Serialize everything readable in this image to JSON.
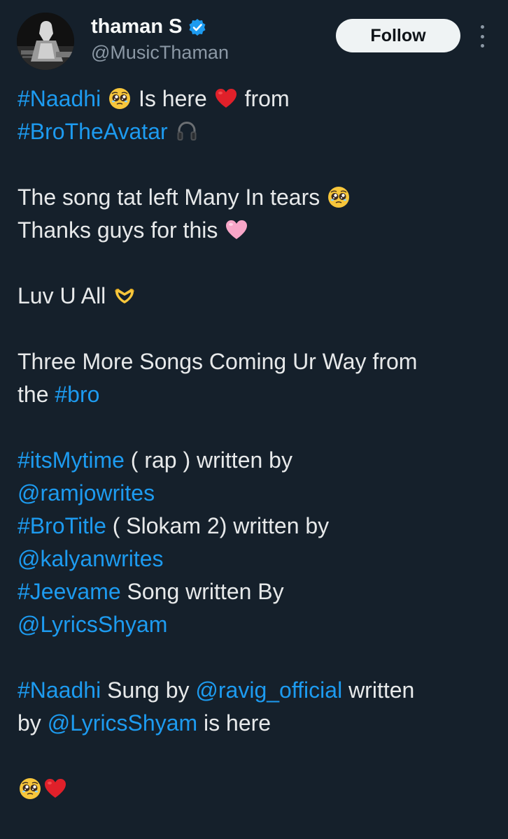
{
  "user": {
    "display_name": "thaman S",
    "handle": "@MusicThaman",
    "verified_icon": "verified-badge-icon",
    "avatar": "profile-avatar"
  },
  "actions": {
    "follow_label": "Follow",
    "more_icon": "more-vertical-icon"
  },
  "colors": {
    "background": "#15202b",
    "text": "#e7e9ea",
    "link": "#1d9bf0",
    "handle": "#8b98a5",
    "follow_button": "#eff3f4"
  },
  "tweet": {
    "l1": {
      "tag_naadhi": "#Naadhi",
      "is_here": " Is here ",
      "from": " from"
    },
    "l2": {
      "tag_brotheavatar": "#BroTheAvatar"
    },
    "l3": {
      "text": "The song tat left Many In tears "
    },
    "l4": {
      "text": "Thanks guys for this "
    },
    "l5": {
      "text": "Luv U All "
    },
    "l6": {
      "text": "Three More Songs Coming Ur Way from"
    },
    "l7": {
      "the": "the ",
      "tag_bro": "#bro"
    },
    "l8": {
      "tag": "#itsMytime",
      "text": " ( rap ) written by"
    },
    "l9": {
      "mention": "@ramjowrites"
    },
    "l10": {
      "tag": "#BroTitle",
      "text": " ( Slokam 2) written by"
    },
    "l11": {
      "mention": "@kalyanwrites"
    },
    "l12": {
      "tag": "#Jeevame",
      "text": " Song written By"
    },
    "l13": {
      "mention": "@LyricsShyam"
    },
    "l14": {
      "tag": "#Naadhi",
      "sung_by": " Sung by ",
      "mention": "@ravig_official",
      "written": " written"
    },
    "l15": {
      "by": "by ",
      "mention": "@LyricsShyam",
      "is_here": " is here"
    },
    "emojis": [
      "pleading-face-emoji",
      "red-heart-emoji",
      "headphone-emoji",
      "pink-heart-emoji",
      "heart-hands-emoji"
    ]
  }
}
